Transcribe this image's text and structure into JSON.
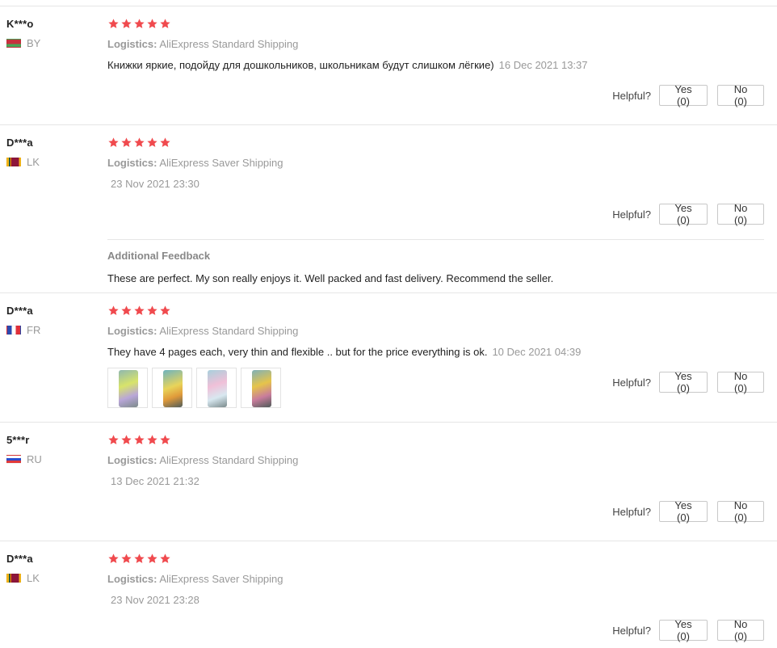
{
  "labels": {
    "logistics_prefix": "Logistics:",
    "helpful": "Helpful?"
  },
  "reviews": [
    {
      "user": "K***o",
      "country": "BY",
      "rating": 5,
      "logistics": "AliExpress Standard Shipping",
      "text": "Книжки яркие, подойду для дошкольников, школьникам будут слишком лёгкие)",
      "date": "16 Dec 2021 13:37",
      "yes": "Yes (0)",
      "no": "No (0)"
    },
    {
      "user": "D***a",
      "country": "LK",
      "rating": 5,
      "logistics": "AliExpress Saver Shipping",
      "text": "",
      "date": "23 Nov 2021 23:30",
      "yes": "Yes (0)",
      "no": "No (0)",
      "additional_title": "Additional Feedback",
      "additional_text": "These are perfect. My son really enjoys it. Well packed and fast delivery. Recommend the seller."
    },
    {
      "user": "D***a",
      "country": "FR",
      "rating": 5,
      "logistics": "AliExpress Standard Shipping",
      "text": "They have 4 pages each, very thin and flexible .. but for the price everything is ok.",
      "date": "10 Dec 2021 04:39",
      "yes": "Yes (0)",
      "no": "No (0)",
      "photo_count": 4
    },
    {
      "user": "5***r",
      "country": "RU",
      "rating": 5,
      "logistics": "AliExpress Standard Shipping",
      "text": "",
      "date": "13 Dec 2021 21:32",
      "yes": "Yes (0)",
      "no": "No (0)"
    },
    {
      "user": "D***a",
      "country": "LK",
      "rating": 5,
      "logistics": "AliExpress Saver Shipping",
      "text": "",
      "date": "23 Nov 2021 23:28",
      "yes": "Yes (0)",
      "no": "No (0)"
    }
  ],
  "colors": {
    "star": "#f04a4e",
    "divider": "#e6e6e6",
    "muted": "#999999"
  }
}
